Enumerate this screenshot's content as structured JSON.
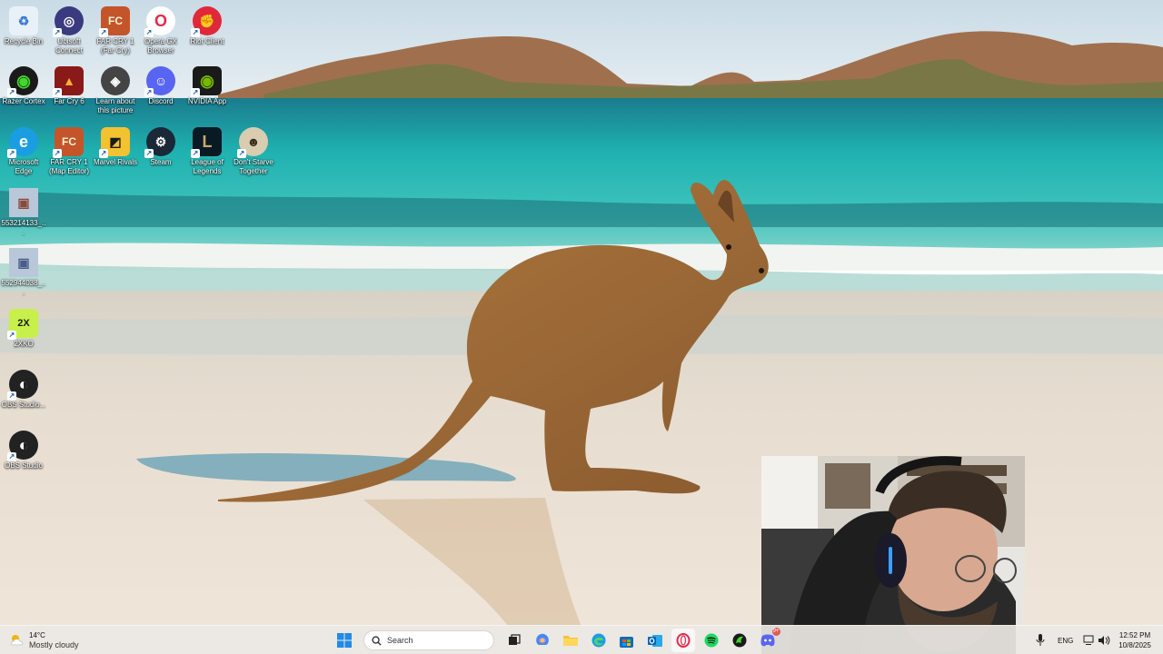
{
  "desktop": {
    "icons": [
      {
        "label": "Recycle Bin",
        "icon": "recycle-bin-icon",
        "bg": "#e9f1f8",
        "glyph": "♻",
        "fg": "#3a7bd5"
      },
      {
        "label": "Ubisoft Connect",
        "icon": "ubisoft-icon",
        "bg": "#3a3a80",
        "glyph": "◎",
        "fg": "#ffffff"
      },
      {
        "label": "FAR CRY 1 (Far Cry)",
        "icon": "far-cry-icon",
        "bg": "#c4552a",
        "glyph": "FC",
        "fg": "#fff2d0"
      },
      {
        "label": "Opera GX Browser",
        "icon": "opera-gx-icon",
        "bg": "#ffffff",
        "glyph": "O",
        "fg": "#e8284a"
      },
      {
        "label": "Riot Client",
        "icon": "riot-client-icon",
        "bg": "#e0283a",
        "glyph": "✊",
        "fg": "#ffffff"
      },
      {
        "label": "Razer Cortex",
        "icon": "razer-cortex-icon",
        "bg": "#1a1a1a",
        "glyph": "◉",
        "fg": "#44d62c"
      },
      {
        "label": "Far Cry 6",
        "icon": "far-cry-6-icon",
        "bg": "#8a1a1a",
        "glyph": "▲",
        "fg": "#ffb030"
      },
      {
        "label": "Learn about this picture",
        "icon": "learn-picture-icon",
        "bg": "#444444",
        "glyph": "◈",
        "fg": "#ffffff"
      },
      {
        "label": "Discord",
        "icon": "discord-icon",
        "bg": "#5865f2",
        "glyph": "☺",
        "fg": "#ffffff"
      },
      {
        "label": "NVIDIA App",
        "icon": "nvidia-icon",
        "bg": "#1a1a1a",
        "glyph": "◉",
        "fg": "#76b900"
      },
      {
        "label": "Microsoft Edge",
        "icon": "edge-icon",
        "bg": "#1b9de2",
        "glyph": "e",
        "fg": "#ffffff"
      },
      {
        "label": "FAR CRY 1 (Map Editor)",
        "icon": "far-cry-map-editor-icon",
        "bg": "#c4552a",
        "glyph": "FC",
        "fg": "#fff2d0"
      },
      {
        "label": "Marvel Rivals",
        "icon": "marvel-rivals-icon",
        "bg": "#f2c230",
        "glyph": "◩",
        "fg": "#1a1a1a"
      },
      {
        "label": "Steam",
        "icon": "steam-icon",
        "bg": "#1b2838",
        "glyph": "⚙",
        "fg": "#ffffff"
      },
      {
        "label": "League of Legends",
        "icon": "league-of-legends-icon",
        "bg": "#0a1a24",
        "glyph": "L",
        "fg": "#c8aa6e"
      },
      {
        "label": "Don't Starve Together",
        "icon": "dont-starve-icon",
        "bg": "#d8cdb0",
        "glyph": "☻",
        "fg": "#3a2a1a"
      },
      {
        "label": "553214133_...",
        "icon": "photo-file-icon",
        "bg": "#b8c8d8",
        "glyph": "▣",
        "fg": "#8a4a3a"
      },
      {
        "label": "552944038_...",
        "icon": "photo-file-icon",
        "bg": "#b8c8d8",
        "glyph": "▣",
        "fg": "#4a5a8a"
      },
      {
        "label": "2XKO",
        "icon": "2xko-icon",
        "bg": "#c8f04a",
        "glyph": "2X",
        "fg": "#1a1a1a"
      },
      {
        "label": "OBS Studio...",
        "icon": "obs-studio-icon",
        "bg": "#222222",
        "glyph": "◐",
        "fg": "#ffffff"
      },
      {
        "label": "OBS Studio",
        "icon": "obs-studio-icon",
        "bg": "#222222",
        "glyph": "◐",
        "fg": "#ffffff"
      }
    ]
  },
  "taskbar": {
    "weather": {
      "temp": "14°C",
      "condition": "Mostly cloudy"
    },
    "search_placeholder": "Search",
    "pinned": [
      {
        "name": "task-view",
        "icon": "task-view-icon"
      },
      {
        "name": "copilot",
        "icon": "copilot-icon"
      },
      {
        "name": "file-explorer",
        "icon": "file-explorer-icon"
      },
      {
        "name": "edge",
        "icon": "edge-icon"
      },
      {
        "name": "store",
        "icon": "store-icon"
      },
      {
        "name": "outlook",
        "icon": "outlook-icon"
      },
      {
        "name": "opera-gx",
        "icon": "opera-gx-icon"
      },
      {
        "name": "spotify",
        "icon": "spotify-icon"
      },
      {
        "name": "razer",
        "icon": "razer-icon"
      },
      {
        "name": "discord",
        "icon": "discord-icon"
      }
    ],
    "discord_badge": "9+",
    "tray": {
      "language": "ENG"
    },
    "clock": {
      "time": "12:52 PM",
      "date": "10/8/2025"
    }
  }
}
